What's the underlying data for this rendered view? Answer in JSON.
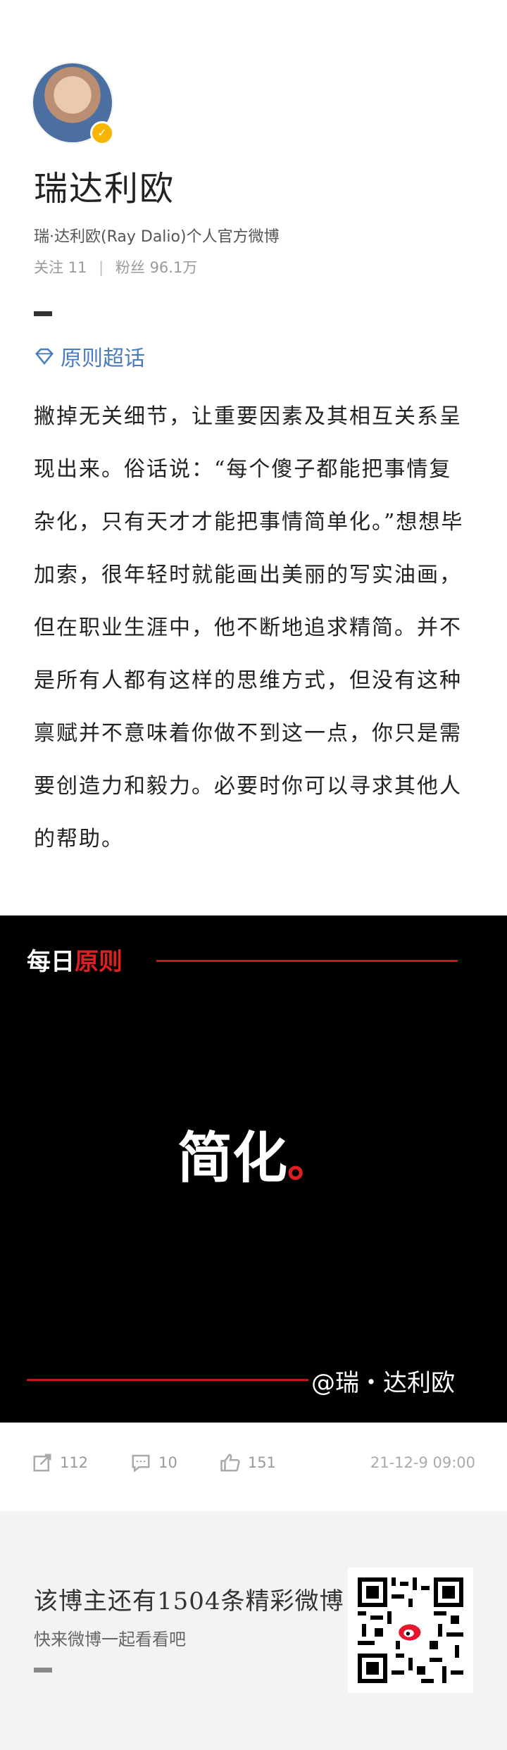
{
  "profile": {
    "name": "瑞达利欧",
    "description": "瑞·达利欧(Ray Dalio)个人官方微博",
    "stats": {
      "following_label": "关注",
      "following_value": "11",
      "followers_label": "粉丝",
      "followers_value": "96.1万"
    },
    "verified_icon": "verified-badge-icon"
  },
  "topic": {
    "icon": "diamond-icon",
    "label": "原则超话"
  },
  "post": {
    "text": "撇掉无关细节，让重要因素及其相互关系呈现出来。俗话说：“每个傻子都能把事情复杂化，只有天才才能把事情简单化。”想想毕加索，很年轻时就能画出美丽的写实油画，但在职业生涯中，他不断地追求精简。并不是所有人都有这样的思维方式，但没有这种禀赋并不意味着你做不到这一点，你只是需要创造力和毅力。必要时你可以寻求其他人的帮助。"
  },
  "poster": {
    "head_white": "每日",
    "head_red": "原则",
    "title": "简化",
    "title_dot": "。",
    "signature": "@瑞・达利欧",
    "colors": {
      "background": "#000000",
      "accent": "#e02020"
    }
  },
  "actions": {
    "repost_count": "112",
    "comment_count": "10",
    "like_count": "151",
    "timestamp": "21-12-9 09:00"
  },
  "footer": {
    "title": "该博主还有1504条精彩微博",
    "subtitle": "快来微博一起看看吧"
  }
}
